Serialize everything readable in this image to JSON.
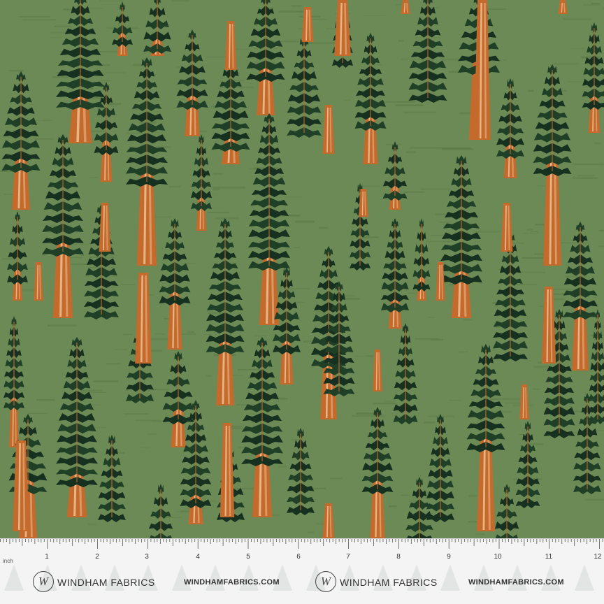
{
  "fabric": {
    "colors": {
      "background": "#6b8a55",
      "background_dark": "#5a7746",
      "foliage": "#16311f",
      "foliage_mid": "#1f3f27",
      "trunk": "#c46a2d",
      "trunk_highlight": "#f0c89a",
      "ruler_bg": "#f4f4f4"
    }
  },
  "ruler": {
    "unit": "inch",
    "numbers": [
      "1",
      "2",
      "3",
      "4",
      "5",
      "6",
      "7",
      "8",
      "9",
      "10",
      "11",
      "12"
    ]
  },
  "branding": [
    {
      "logo_letter": "W",
      "name": "WINDHAM FABRICS",
      "url": "WINDHAMFABRICS.COM"
    },
    {
      "logo_letter": "W",
      "name": "WINDHAM FABRICS",
      "url": "WINDHAMFABRICS.COM"
    }
  ]
}
